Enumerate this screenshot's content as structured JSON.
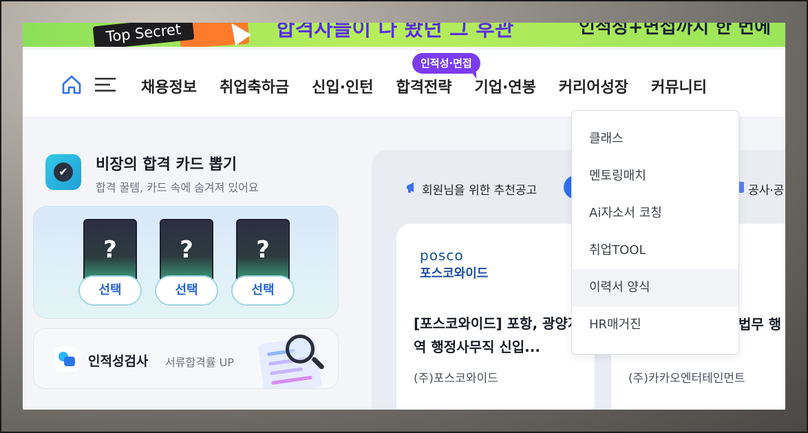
{
  "banner": {
    "badge": "Top Secret",
    "headline": "합격자들이 다 봤던 그 후관",
    "subline": "인적성+면접까지 한 번에"
  },
  "header": {
    "nav": [
      "채용정보",
      "취업축하금",
      "신입·인턴",
      "합격전략",
      "기업·연봉",
      "커리어성장",
      "커뮤니티"
    ],
    "badge": "인적성·면접"
  },
  "dropdown": {
    "items": [
      "클래스",
      "멘토링매치",
      "Ai자소서 코칭",
      "취업TOOL",
      "이력서 양식",
      "HR매거진"
    ]
  },
  "promo": {
    "title": "비장의 합격 카드 뽑기",
    "subtitle": "합격 꿀템, 카드 속에 숨겨져 있어요",
    "card_mark": "?",
    "select_label": "선택"
  },
  "aptitude": {
    "title": "인적성검사",
    "subtitle": "서류합격률 UP"
  },
  "recommend": {
    "label": "회원님을 위한 추천공고",
    "gov_label": "공사·공"
  },
  "jobs": [
    {
      "logo": "posco",
      "logo_sub": "포스코와이드",
      "title": "[포스코와이드] 포항, 광양지역 행정사무직 신입...",
      "company": "(주)포스코와이드"
    },
    {
      "title": "법무 행",
      "company": "(주)카카오엔터테인먼트"
    }
  ],
  "colors": {
    "accent": "#7b3cf2",
    "primary": "#2f6ff0",
    "banner": "#b9ee5c"
  }
}
